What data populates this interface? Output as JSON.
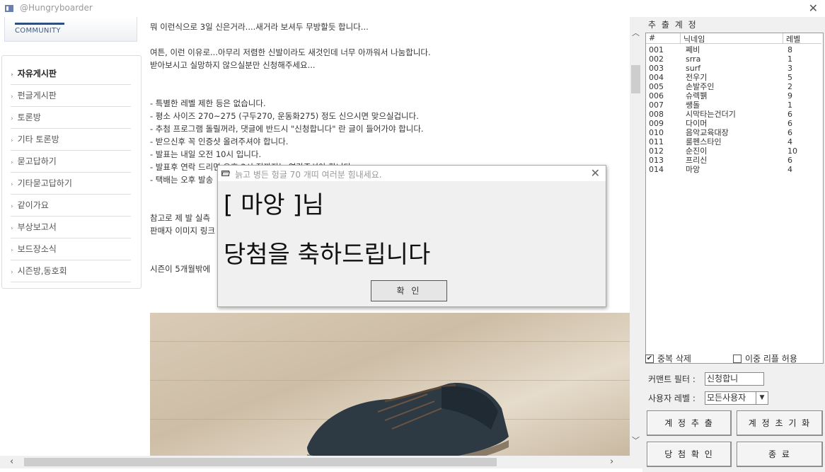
{
  "window": {
    "title": "@Hungryboarder"
  },
  "site": {
    "logo_text": "COMMUNITY"
  },
  "sidebar": {
    "items": [
      {
        "label": "자유게시판"
      },
      {
        "label": "펀글게시판"
      },
      {
        "label": "토론방"
      },
      {
        "label": "기타 토론방"
      },
      {
        "label": "묻고답하기"
      },
      {
        "label": "기타묻고답하기"
      },
      {
        "label": "같이가요"
      },
      {
        "label": "부상보고서"
      },
      {
        "label": "보드장소식"
      },
      {
        "label": "시즌방,동호회"
      }
    ]
  },
  "article": {
    "lines": [
      "뭐 이런식으로 3일 신은거라....새거라 보셔두 무방할듯 합니다...",
      "여튼, 이런 이유로...아무리 저렴한 신발이라도 새것인데 너무 아까워서 나눔합니다.",
      "받아보시고 실망하지 않으실분만 신청해주세요...",
      "- 특별한 레벨 제한 등은 없습니다.",
      "- 평소 사이즈 270~275 (구두270, 운동화275) 정도 신으시면 맞으실겁니다.",
      "- 추첨 프로그램 돌릴꺼라, 댓글에 반드시 \"신청합니다\" 란 글이 들어가야 합니다.",
      "- 받으신후 꼭 인증샷 올려주셔야 합니다.",
      "- 발표는 내일 오전 10시 입니다.",
      "- 발표후 연락 드리면 오후 3시 전까지는 연락주셔야 합니다.",
      "- 택배는 오후 발송",
      "참고로 제 발 실측",
      "판매자 이미지 링크",
      "시즌이 5개월밖에"
    ]
  },
  "panel": {
    "title": "추 출 계 정",
    "columns": [
      "#",
      "닉네임",
      "레벨"
    ],
    "rows": [
      {
        "num": "001",
        "nick": "쩨비",
        "level": "8"
      },
      {
        "num": "002",
        "nick": "srra",
        "level": "1"
      },
      {
        "num": "003",
        "nick": "surf",
        "level": "3"
      },
      {
        "num": "004",
        "nick": "전우기",
        "level": "5"
      },
      {
        "num": "005",
        "nick": "손발주인",
        "level": "2"
      },
      {
        "num": "006",
        "nick": "슈렉뷁",
        "level": "9"
      },
      {
        "num": "007",
        "nick": "쌩돌",
        "level": "1"
      },
      {
        "num": "008",
        "nick": "시막타는건더기",
        "level": "6"
      },
      {
        "num": "009",
        "nick": "다이머",
        "level": "6"
      },
      {
        "num": "010",
        "nick": "음악교육대장",
        "level": "6"
      },
      {
        "num": "011",
        "nick": "룰펜스타인",
        "level": "4"
      },
      {
        "num": "012",
        "nick": "순진이",
        "level": "10"
      },
      {
        "num": "013",
        "nick": "프리신",
        "level": "6"
      },
      {
        "num": "014",
        "nick": "마앙",
        "level": "4"
      }
    ],
    "dup_delete": {
      "label": "중복 삭제",
      "checked": true
    },
    "double_reply": {
      "label": "이중 리플 허용",
      "checked": false
    },
    "comment_filter": {
      "label": "커맨트 필터 :",
      "value": "신청합니"
    },
    "user_level": {
      "label": "사용자 레벨 :",
      "value": "모든사용자"
    },
    "buttons": {
      "extract": "계 정 추 출",
      "reset": "계 정 초 기 화",
      "winner": "당 첨 확 인",
      "exit": "종 료"
    }
  },
  "dialog": {
    "title": "늙고 병든 헝글 70 개띠 여러분 힘내세요.",
    "line1": "[ 마앙 ]님",
    "line2": "당첨을 축하드립니다",
    "ok": "확 인"
  }
}
